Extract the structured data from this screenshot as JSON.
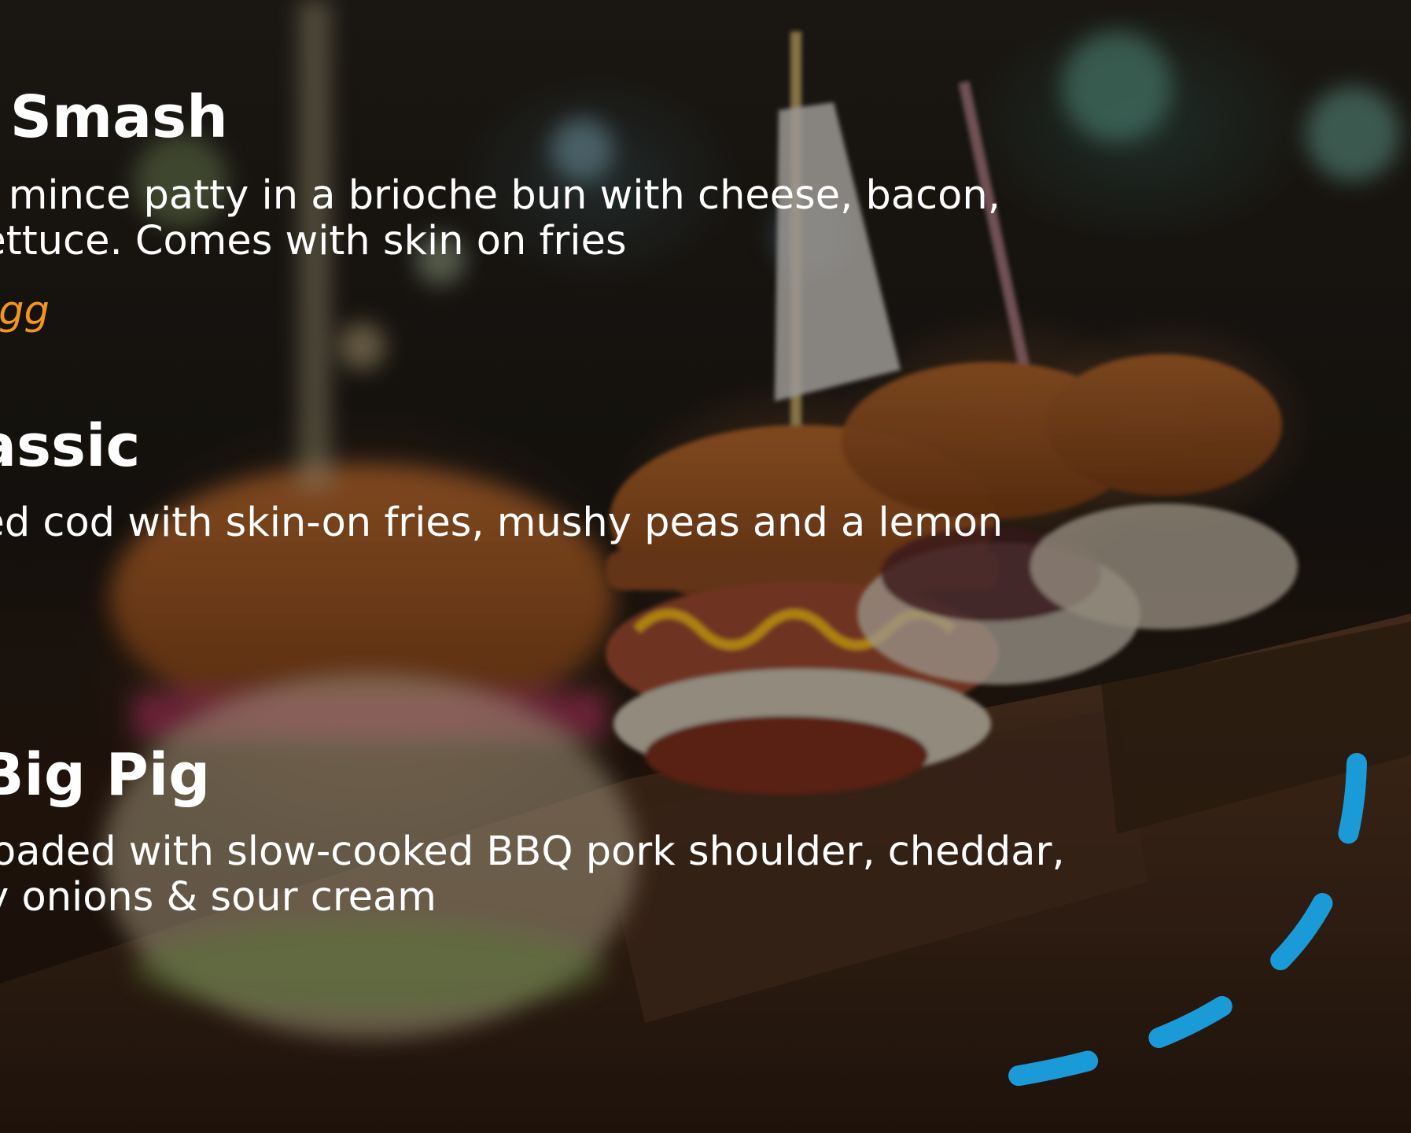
{
  "menu": {
    "items": [
      {
        "title": "Classic Smash",
        "description": "Steak mince patty in a brioche bun with cheese, bacon,\nand lettuce. Comes with skin on fries",
        "extra": "Add Egg"
      },
      {
        "title": "Fish Classic",
        "description": "Battered cod with skin-on fries, mushy peas and a lemon"
      },
      {
        "title": "The Big Pig",
        "description": "Bun loaded with slow-cooked BBQ pork shoulder, cheddar,\ncrispy onions & sour cream"
      }
    ]
  },
  "colors": {
    "title_text": "#ffffff",
    "description_text": "#ffffff",
    "extra_accent": "#f0961e",
    "decoration_accent": "#1b9ad8"
  },
  "icons": {
    "decoration": "dashed-arc-decoration"
  }
}
